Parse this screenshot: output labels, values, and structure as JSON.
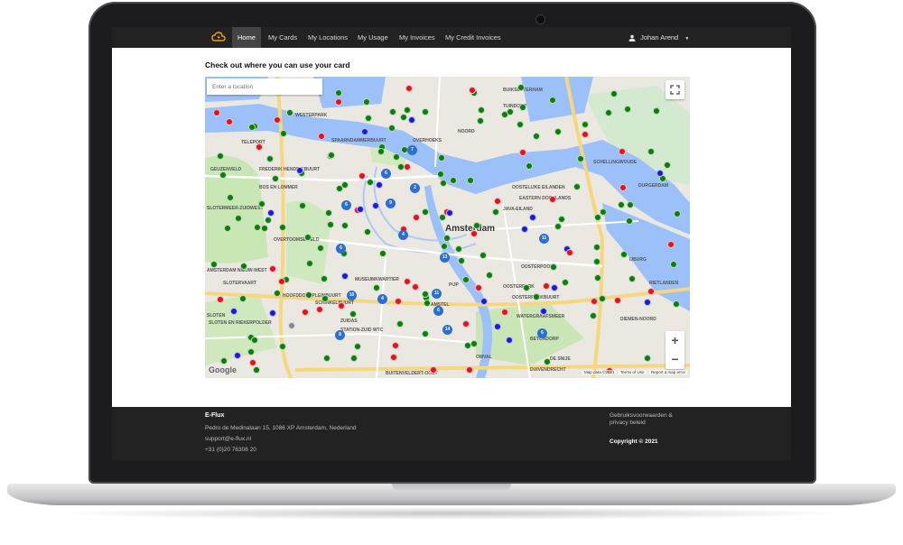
{
  "nav": {
    "items": [
      {
        "label": "Home",
        "active": true
      },
      {
        "label": "My Cards",
        "active": false
      },
      {
        "label": "My Locations",
        "active": false
      },
      {
        "label": "My Usage",
        "active": false
      },
      {
        "label": "My Invoices",
        "active": false
      },
      {
        "label": "My Credit Invoices",
        "active": false
      }
    ],
    "user_name": "Johan Arend"
  },
  "main": {
    "title": "Check out where you can use your card",
    "search_placeholder": "Enter a location"
  },
  "map": {
    "city_label": "Amsterdam",
    "attribution_brand": "Google",
    "map_data": "Map data ©2021",
    "terms_label": "Terms of Use",
    "report_label": "Report a map error",
    "zoom_in": "+",
    "zoom_out": "−",
    "labels": [
      "BUIKSLOTERHAM",
      "SPAARNDAMMERBUURT",
      "NOORD",
      "OOSTERPARKBUURT",
      "OOSTELIJKE EILANDEN",
      "AMSTERDAM NIEUW-WEST",
      "SLOTEN EN RIEKERPOLDER",
      "BUITENVELDERT-OOST",
      "DUIVENDRECHT",
      "WATERGRAAFSMEER",
      "BETONDORP",
      "DIEMEN-NOORD",
      "DURGERDAM",
      "SCHELLINGWOUDE",
      "OVERHOEKS",
      "TELEPORT",
      "SLOTERMEER-ZUIDWEST",
      "OVERTOOMSE VELD",
      "DE SNIJE",
      "RIETLANDEN",
      "EASTERN DOCKLANDS",
      "MUSEUMKWARTIER",
      "STATION-ZUID WTC",
      "ZUIDAS",
      "SCHINKELBUURT",
      "WESTERPARK",
      "FREDERIK HENDRIKBUURT",
      "OMVAL",
      "TUINDORP",
      "OOSTERPOORT",
      "AMSTEL",
      "SLOTEN",
      "JAVA-EILAND",
      "IJBURG",
      "BOS EN LOMMER",
      "HOOFDDORPPLEINBUURT",
      "SLOTERVAART",
      "GEUZENVELD",
      "PIJP",
      "OOSTERPARK"
    ],
    "clusters": [
      "7",
      "6",
      "2",
      "9",
      "6",
      "4",
      "6",
      "13",
      "10",
      "11",
      "4",
      "6",
      "14",
      "8",
      "11",
      "6"
    ],
    "marker_colors": {
      "available": "#0a7d0a",
      "occupied": "#e0141e",
      "reserved": "#1a1adb",
      "unknown": "#888888",
      "cluster": "#2a6fd1"
    }
  },
  "footer": {
    "brand": "E-Flux",
    "address": "Pedro de Medinalaan 15, 1086 XP Amsterdam, Nederland",
    "email": "support@e-flux.nl",
    "phone": "+31 (0)20 76306 20",
    "terms": "Gebruiksvoorwaarden & privacy beleid",
    "copyright": "Copyright © 2021"
  }
}
